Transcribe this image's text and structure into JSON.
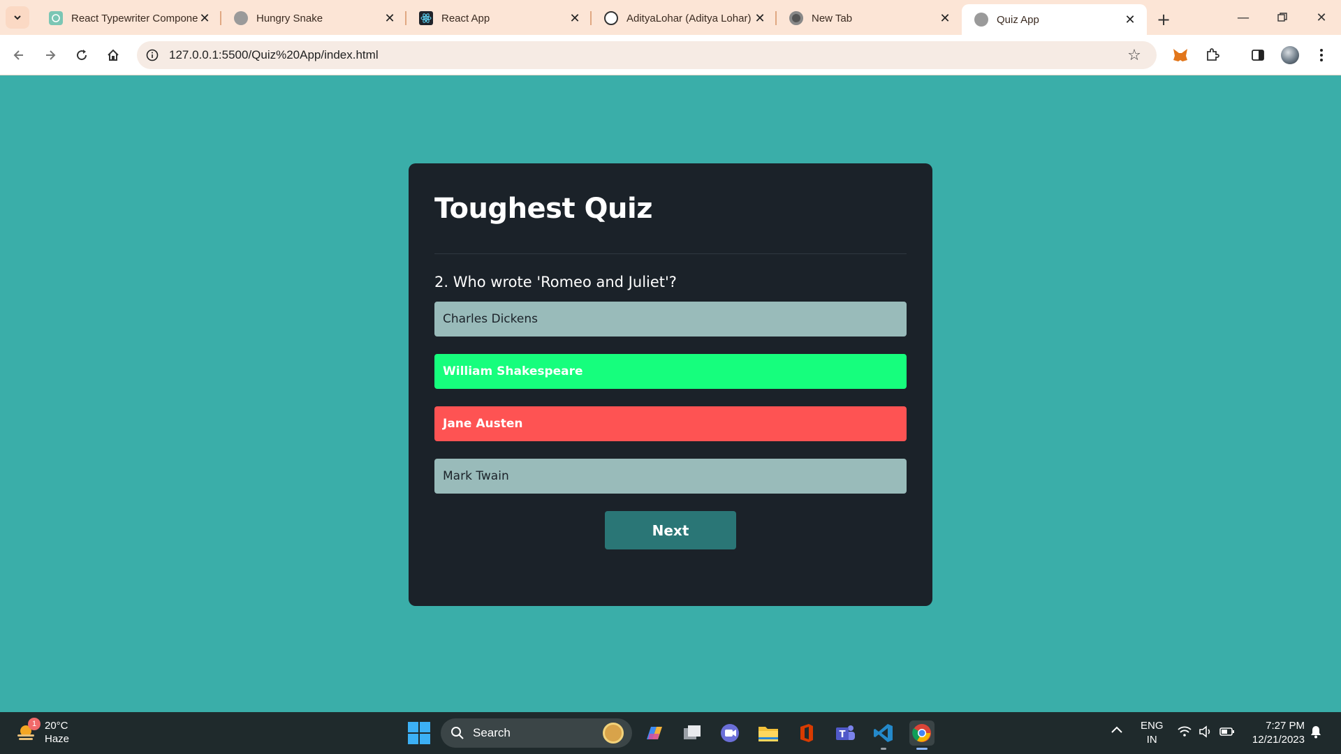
{
  "browser": {
    "tabs": [
      {
        "title": "React Typewriter Compone",
        "icon": "react-typewriter-favicon-icon",
        "active": false
      },
      {
        "title": "Hungry Snake",
        "icon": "globe-icon",
        "active": false
      },
      {
        "title": "React App",
        "icon": "react-favicon-icon",
        "active": false
      },
      {
        "title": "AdityaLohar (Aditya Lohar)",
        "icon": "github-icon",
        "active": false
      },
      {
        "title": "New Tab",
        "icon": "chrome-icon",
        "active": false
      },
      {
        "title": "Quiz App",
        "icon": "globe-icon",
        "active": true
      }
    ],
    "url": "127.0.0.1:5500/Quiz%20App/index.html"
  },
  "quiz": {
    "title": "Toughest Quiz",
    "question": "2. Who wrote 'Romeo and Juliet'?",
    "answers": [
      {
        "label": "Charles Dickens",
        "state": "disabled"
      },
      {
        "label": "William Shakespeare",
        "state": "correct"
      },
      {
        "label": "Jane Austen",
        "state": "wrong"
      },
      {
        "label": "Mark Twain",
        "state": "disabled"
      }
    ],
    "next_label": "Next",
    "colors": {
      "background": "#3aaea9",
      "card": "#1b2229",
      "correct": "#16fe7d",
      "wrong": "#fe5353",
      "neutral": "#99bbba",
      "next_button": "#2a7676"
    }
  },
  "taskbar": {
    "weather": {
      "temp": "20°C",
      "condition": "Haze",
      "badge": "1"
    },
    "search_label": "Search",
    "language": {
      "line1": "ENG",
      "line2": "IN"
    },
    "time": "7:27 PM",
    "date": "12/21/2023"
  }
}
